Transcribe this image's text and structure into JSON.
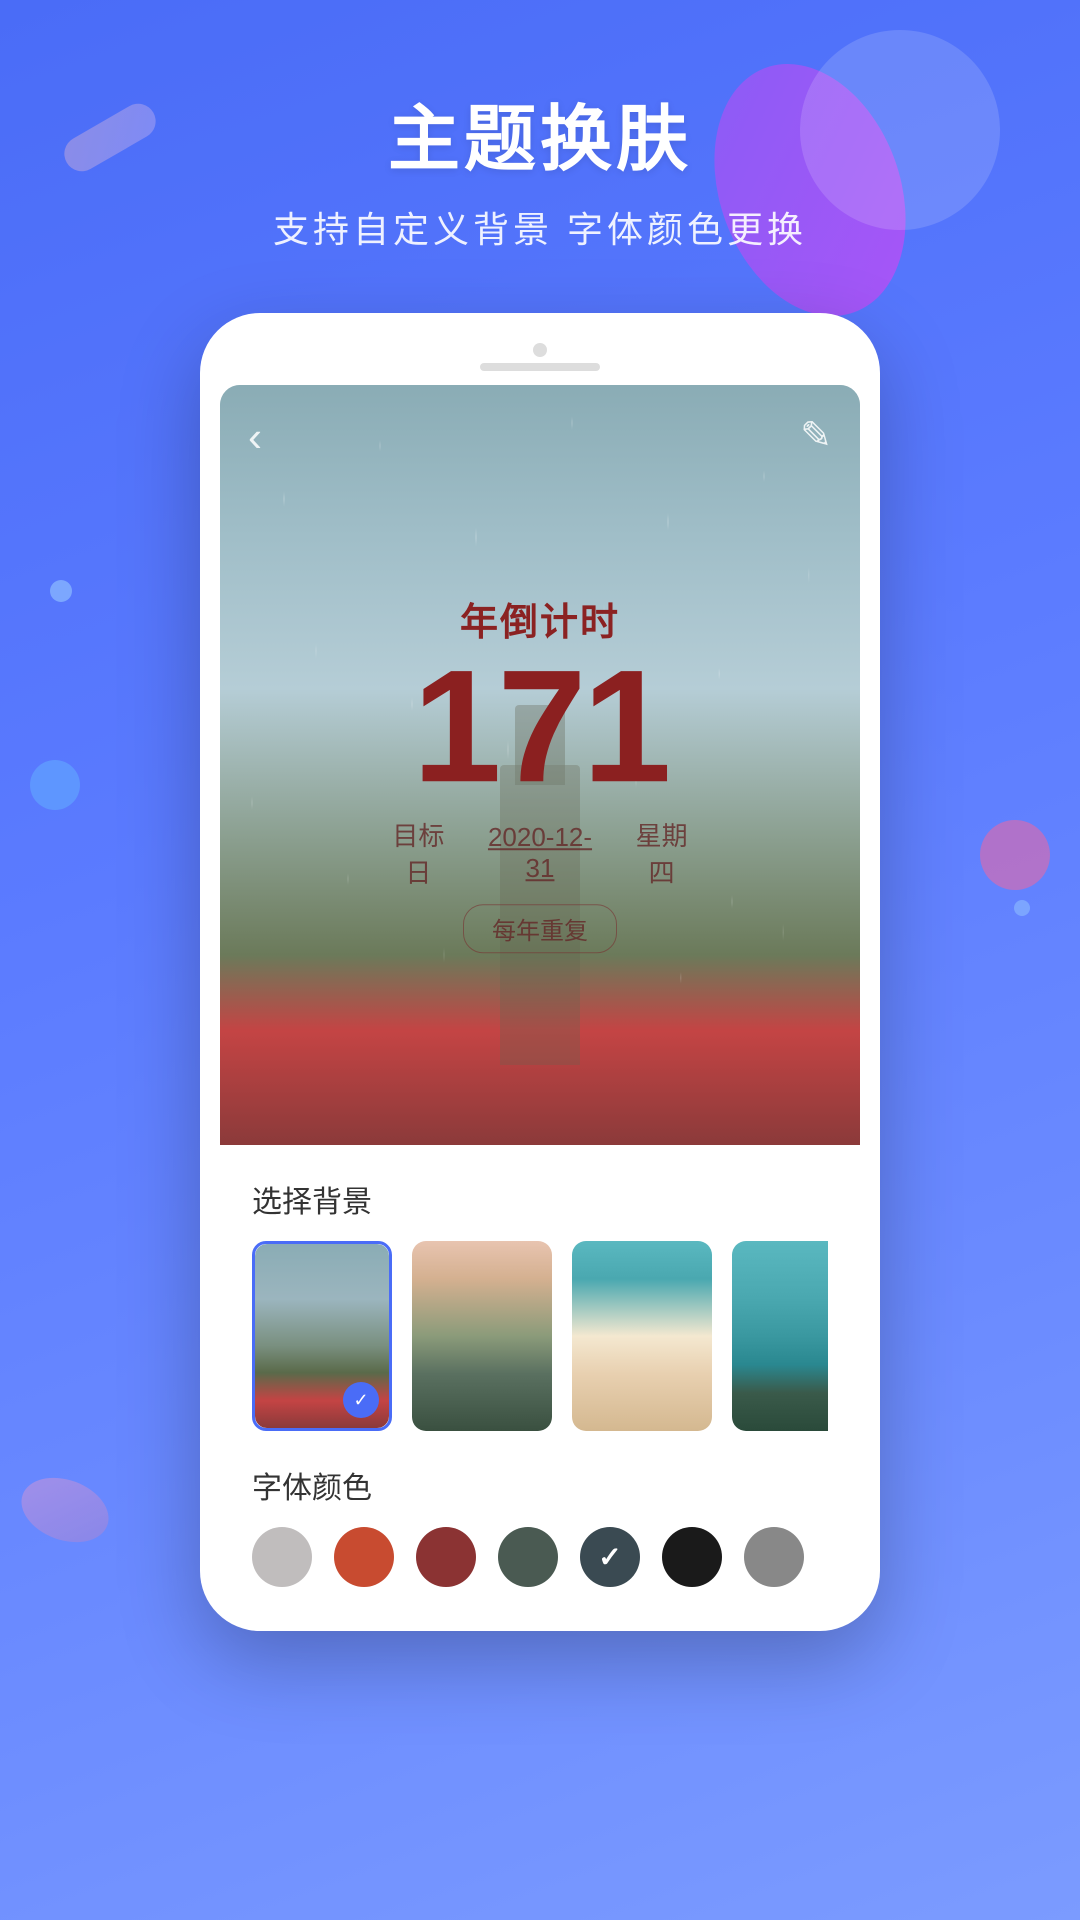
{
  "header": {
    "title": "主题换肤",
    "subtitle": "支持自定义背景  字体颜色更换"
  },
  "countdown": {
    "label": "年倒计时",
    "number": "171",
    "date_label": "目标日",
    "date_value": "2020-12-31",
    "weekday": "星期四",
    "repeat_badge": "每年重复",
    "back_icon": "‹",
    "edit_icon": "✎"
  },
  "background_section": {
    "label": "选择背景",
    "thumbnails": [
      {
        "id": "thumb-1",
        "selected": true
      },
      {
        "id": "thumb-2",
        "selected": false
      },
      {
        "id": "thumb-3",
        "selected": false
      },
      {
        "id": "thumb-4",
        "selected": false
      },
      {
        "id": "thumb-5",
        "selected": false
      }
    ]
  },
  "font_color_section": {
    "label": "字体颜色",
    "colors": [
      {
        "id": "color-gray",
        "hex": "#C0BDBD",
        "selected": false
      },
      {
        "id": "color-red-orange",
        "hex": "#C84B30",
        "selected": false
      },
      {
        "id": "color-dark-red",
        "hex": "#8B3333",
        "selected": false
      },
      {
        "id": "color-dark-green",
        "hex": "#4A5A52",
        "selected": false
      },
      {
        "id": "color-dark-blue-gray",
        "hex": "#3A4A52",
        "selected": true
      },
      {
        "id": "color-black",
        "hex": "#1A1A1A",
        "selected": false
      },
      {
        "id": "color-medium-gray",
        "hex": "#888888",
        "selected": false
      }
    ]
  }
}
